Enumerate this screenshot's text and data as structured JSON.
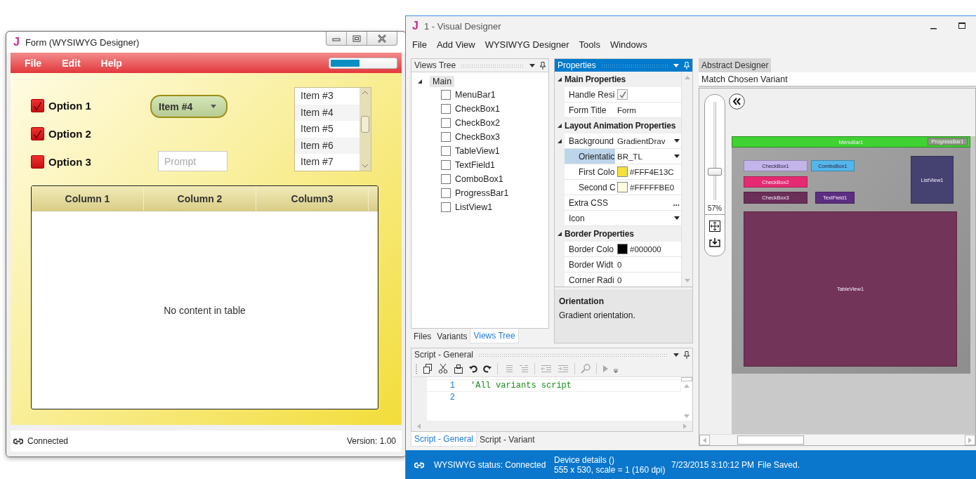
{
  "form_window": {
    "app_letter": "J",
    "title": "Form (WYSIWYG Designer)",
    "menu": [
      "File",
      "Edit",
      "Help"
    ],
    "progress": {
      "level": 0.45
    },
    "options": [
      {
        "label": "Option 1",
        "checked": true
      },
      {
        "label": "Option 2",
        "checked": true
      },
      {
        "label": "Option 3",
        "checked": false
      }
    ],
    "combo": {
      "value": "Item #4"
    },
    "text_field": {
      "placeholder": "Prompt"
    },
    "list": {
      "items": [
        "Item #3",
        "Item #4",
        "Item #5",
        "Item #6",
        "Item #7"
      ]
    },
    "table": {
      "columns": [
        "Column 1",
        "Column 2",
        "Column3"
      ],
      "empty_text": "No content in table"
    },
    "status": {
      "text": "Connected",
      "version": "Version: 1.00"
    }
  },
  "designer_window": {
    "app_letter": "J",
    "title": "1 - Visual Designer",
    "menu": [
      "File",
      "Add View",
      "WYSIWYG Designer",
      "Tools",
      "Windows"
    ],
    "views_tree": {
      "title": "Views Tree",
      "root": {
        "label": "Main",
        "expanded": true,
        "selected": true,
        "children": [
          {
            "label": "MenuBar1",
            "checked": false
          },
          {
            "label": "CheckBox1",
            "checked": false
          },
          {
            "label": "CheckBox2",
            "checked": false
          },
          {
            "label": "CheckBox3",
            "checked": false
          },
          {
            "label": "TableView1",
            "checked": false
          },
          {
            "label": "TextField1",
            "checked": false
          },
          {
            "label": "ComboBox1",
            "checked": false
          },
          {
            "label": "ProgressBar1",
            "checked": false
          },
          {
            "label": "ListView1",
            "checked": false
          }
        ]
      }
    },
    "left_tabs": [
      {
        "label": "Files",
        "selected": false
      },
      {
        "label": "Variants",
        "selected": false
      },
      {
        "label": "Views Tree",
        "selected": true
      }
    ],
    "properties": {
      "title": "Properties",
      "sections": [
        {
          "title": "Main Properties",
          "expanded": true,
          "rows": [
            {
              "kind": "check",
              "name": "Handle Resi",
              "checked": true,
              "selected": false
            },
            {
              "kind": "text",
              "name": "Form Title",
              "value": "Form",
              "selected": false
            }
          ]
        },
        {
          "title": "Layout Animation Properties",
          "expanded": true,
          "rows": [
            {
              "kind": "dropdown",
              "name": "Background",
              "value": "GradientDrav",
              "expanded": true,
              "selected": false,
              "children": [
                {
                  "kind": "dropdown",
                  "name": "Orientatic",
                  "value": "BR_TL",
                  "selected": true
                },
                {
                  "kind": "color",
                  "name": "First Colo",
                  "color": "#f4e13c",
                  "value": "#FFF4E13C",
                  "selected": false
                },
                {
                  "kind": "color",
                  "name": "Second C",
                  "color": "#fffbe0",
                  "value": "#FFFFFBE0",
                  "selected": false
                }
              ]
            },
            {
              "kind": "ellipsis",
              "name": "Extra CSS",
              "value": "...",
              "selected": false
            },
            {
              "kind": "dropdown",
              "name": "Icon",
              "selected": false
            }
          ]
        },
        {
          "title": "Border Properties",
          "expanded": true,
          "rows": [
            {
              "kind": "color",
              "name": "Border Colo",
              "color": "#000000",
              "value": "#000000",
              "selected": false
            },
            {
              "kind": "text",
              "name": "Border Widt",
              "value": "0",
              "selected": false
            },
            {
              "kind": "text",
              "name": "Corner Radi",
              "value": "0",
              "selected": false
            }
          ]
        }
      ]
    },
    "description": {
      "title": "Orientation",
      "text": "Gradient orientation."
    },
    "script": {
      "title": "Script - General",
      "lines": [
        {
          "number": "1",
          "code": "'All variants script"
        },
        {
          "number": "2"
        }
      ]
    },
    "script_tabs": [
      {
        "label": "Script - General",
        "selected": true
      },
      {
        "label": "Script - Variant",
        "selected": false
      }
    ],
    "abstract_designer": {
      "tab": "Abstract Designer",
      "variant_field": {
        "value": "Match Chosen Variant"
      },
      "zoom": {
        "level": 0.27,
        "reading": "57%"
      },
      "views": [
        {
          "label": "MenuBar1",
          "color": "#40d232"
        },
        {
          "label": "ProgressBar1",
          "color": "#8b9a80"
        },
        {
          "label": "CheckBox1",
          "color": "#c3b5ea"
        },
        {
          "label": "ComboBox1",
          "color": "#54b6ea"
        },
        {
          "label": "CheckBox2",
          "color": "#e62a72"
        },
        {
          "label": "CheckBox3",
          "color": "#6a2f58"
        },
        {
          "label": "TextField1",
          "color": "#5c2d80"
        },
        {
          "label": "ListView1",
          "color": "#454272"
        },
        {
          "label": "TableView1",
          "color": "#733459"
        }
      ]
    },
    "status": {
      "connection": "WYSIWYG status: Connected",
      "device_title": "Device details ()",
      "device_info": "555 x 530, scale = 1 (160 dpi)",
      "timestamp": "7/23/2015 3:10:12 PM",
      "message": "File Saved."
    }
  }
}
